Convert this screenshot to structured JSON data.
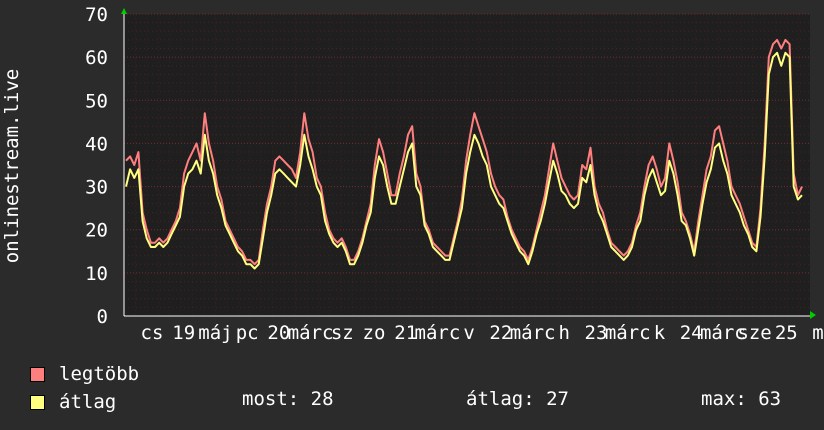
{
  "chart_data": {
    "type": "line",
    "ylabel": "onlinestream.live",
    "ylim": [
      0,
      70
    ],
    "yticks": [
      0,
      10,
      20,
      30,
      40,
      50,
      60,
      70
    ],
    "xlabels": [
      "cs",
      "19",
      "máj",
      "pc",
      "20",
      "márc",
      "sz",
      "zo",
      "21",
      "márc",
      "v",
      "22",
      "márc",
      "h",
      "23",
      "márc",
      "k",
      "24",
      "márc",
      "sze",
      "25",
      "m"
    ],
    "grid": true,
    "legend_placement": "bottom-left",
    "series": [
      {
        "name": "legtöbb",
        "color": "#ff7f7f",
        "values": [
          36,
          37,
          35,
          38,
          24,
          20,
          17,
          17,
          18,
          17,
          18,
          20,
          22,
          25,
          33,
          36,
          38,
          40,
          36,
          47,
          40,
          36,
          30,
          27,
          22,
          20,
          18,
          16,
          15,
          13,
          13,
          12,
          13,
          20,
          26,
          30,
          36,
          37,
          36,
          35,
          34,
          32,
          38,
          47,
          41,
          38,
          32,
          30,
          24,
          20,
          18,
          17,
          18,
          16,
          13,
          13,
          15,
          18,
          22,
          26,
          35,
          41,
          38,
          33,
          28,
          28,
          33,
          37,
          42,
          44,
          33,
          30,
          22,
          20,
          17,
          16,
          15,
          14,
          14,
          18,
          22,
          27,
          36,
          42,
          47,
          44,
          41,
          38,
          33,
          30,
          28,
          27,
          23,
          20,
          18,
          16,
          15,
          13,
          16,
          20,
          24,
          28,
          34,
          40,
          36,
          32,
          30,
          28,
          27,
          28,
          35,
          34,
          39,
          30,
          26,
          24,
          20,
          17,
          16,
          15,
          14,
          15,
          17,
          21,
          24,
          30,
          35,
          37,
          34,
          30,
          32,
          40,
          36,
          31,
          24,
          22,
          19,
          15,
          22,
          28,
          34,
          37,
          43,
          44,
          40,
          36,
          30,
          28,
          26,
          23,
          20,
          17,
          16,
          25,
          40,
          60,
          63,
          64,
          62,
          64,
          63,
          33,
          28,
          30
        ]
      },
      {
        "name": "átlag",
        "color": "#ffff80",
        "values": [
          30,
          34,
          32,
          34,
          22,
          18,
          16,
          16,
          17,
          16,
          17,
          19,
          21,
          23,
          30,
          33,
          34,
          36,
          33,
          42,
          36,
          33,
          28,
          25,
          21,
          19,
          17,
          15,
          14,
          12,
          12,
          11,
          12,
          18,
          24,
          28,
          33,
          34,
          33,
          32,
          31,
          30,
          35,
          42,
          37,
          34,
          30,
          28,
          22,
          19,
          17,
          16,
          17,
          15,
          12,
          12,
          14,
          17,
          21,
          24,
          32,
          37,
          35,
          30,
          26,
          26,
          30,
          34,
          38,
          40,
          30,
          28,
          21,
          19,
          16,
          15,
          14,
          13,
          13,
          17,
          21,
          25,
          33,
          38,
          42,
          40,
          37,
          35,
          30,
          28,
          26,
          25,
          22,
          19,
          17,
          15,
          14,
          12,
          15,
          19,
          22,
          26,
          31,
          36,
          33,
          29,
          28,
          26,
          25,
          26,
          32,
          31,
          35,
          28,
          24,
          22,
          19,
          16,
          15,
          14,
          13,
          14,
          16,
          20,
          22,
          28,
          32,
          34,
          31,
          28,
          29,
          36,
          33,
          28,
          22,
          21,
          18,
          14,
          20,
          26,
          31,
          34,
          39,
          40,
          36,
          33,
          28,
          26,
          24,
          21,
          19,
          16,
          15,
          23,
          37,
          56,
          60,
          61,
          58,
          61,
          60,
          30,
          27,
          28
        ]
      }
    ]
  },
  "legend": [
    {
      "label": "legtöbb",
      "color": "#ff7f7f"
    },
    {
      "label": "átlag",
      "color": "#ffff80"
    }
  ],
  "stats": {
    "most": "most: 28",
    "atlag": "átlag: 27",
    "max": "max: 63"
  },
  "colors": {
    "background": "#2b2b2b",
    "plot_background": "#1f1f1f",
    "grid": "#7a2a2a",
    "axis_arrow": "#00cc00"
  }
}
